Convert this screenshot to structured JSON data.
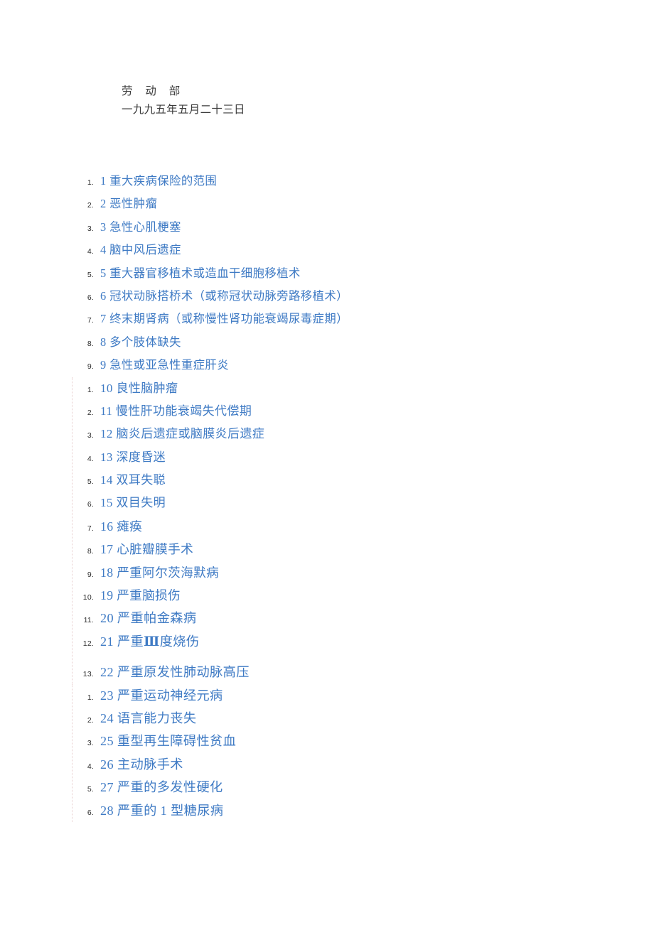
{
  "document": {
    "header": {
      "agency": "劳 动 部",
      "date": "一九九五年五月二十三日"
    },
    "groups": [
      {
        "dotted_border": false,
        "items": [
          {
            "marker": "1.",
            "text": "1 重大疾病保险的范围",
            "size": "sz-1"
          },
          {
            "marker": "2.",
            "text": "2 恶性肿瘤",
            "size": "sz-1"
          },
          {
            "marker": "3.",
            "text": "3 急性心肌梗塞",
            "size": "sz-1"
          },
          {
            "marker": "4.",
            "text": "4 脑中风后遗症",
            "size": "sz-1"
          },
          {
            "marker": "5.",
            "text": "5 重大器官移植术或造血干细胞移植术",
            "size": "sz-1"
          },
          {
            "marker": "6.",
            "text": "6 冠状动脉搭桥术（或称冠状动脉旁路移植术）",
            "size": "sz-1"
          },
          {
            "marker": "7.",
            "text": "7 终末期肾病（或称慢性肾功能衰竭尿毒症期）",
            "size": "sz-1"
          },
          {
            "marker": "8.",
            "text": "8 多个肢体缺失",
            "size": "sz-1"
          },
          {
            "marker": "9.",
            "text": "9 急性或亚急性重症肝炎",
            "size": "sz-1"
          }
        ]
      },
      {
        "dotted_border": true,
        "items": [
          {
            "marker": "1.",
            "text": "10 良性脑肿瘤",
            "size": "sz-2"
          },
          {
            "marker": "2.",
            "text": "11 慢性肝功能衰竭失代偿期",
            "size": "sz-2"
          },
          {
            "marker": "3.",
            "text": "12 脑炎后遗症或脑膜炎后遗症",
            "size": "sz-2"
          },
          {
            "marker": "4.",
            "text": "13 深度昏迷",
            "size": "sz-2"
          },
          {
            "marker": "5.",
            "text": "14 双耳失聪",
            "size": "sz-2"
          },
          {
            "marker": "6.",
            "text": "15 双目失明",
            "size": "sz-2"
          },
          {
            "marker": "7.",
            "text": "16 瘫痪",
            "size": "sz-3"
          },
          {
            "marker": "8.",
            "text": "17 心脏瓣膜手术",
            "size": "sz-3"
          },
          {
            "marker": "9.",
            "text": "18 严重阿尔茨海默病",
            "size": "sz-3"
          },
          {
            "marker": "10.",
            "text": "19 严重脑损伤",
            "size": "sz-3"
          },
          {
            "marker": "11.",
            "text": "20 严重帕金森病",
            "size": "sz-4"
          },
          {
            "marker": "12.",
            "text_parts": [
              {
                "content": "21 严重",
                "roman": false
              },
              {
                "content": "Ⅲ",
                "roman": true
              },
              {
                "content": "度烧伤",
                "roman": false
              }
            ],
            "text": "21 严重Ⅲ度烧伤",
            "size": "sz-4"
          },
          {
            "marker": "13.",
            "text": "22 严重原发性肺动脉高压",
            "size": "sz-4",
            "gap_before": true
          }
        ]
      },
      {
        "dotted_border": true,
        "items": [
          {
            "marker": "1.",
            "text": "23 严重运动神经元病",
            "size": "sz-4"
          },
          {
            "marker": "2.",
            "text": "24 语言能力丧失",
            "size": "sz-4"
          },
          {
            "marker": "3.",
            "text": "25 重型再生障碍性贫血",
            "size": "sz-4"
          },
          {
            "marker": "4.",
            "text": "26 主动脉手术",
            "size": "sz-4"
          },
          {
            "marker": "5.",
            "text": "27 严重的多发性硬化",
            "size": "sz-4"
          },
          {
            "marker": "6.",
            "text": "28 严重的 1 型糖尿病",
            "size": "sz-4"
          }
        ]
      }
    ]
  },
  "colors": {
    "link_blue": "#3e7ac4",
    "marker_gray": "#2e2e2e",
    "header_text": "#3b3b3b",
    "dotted_border": "#e8cfcf",
    "page_background": "#ffffff"
  }
}
